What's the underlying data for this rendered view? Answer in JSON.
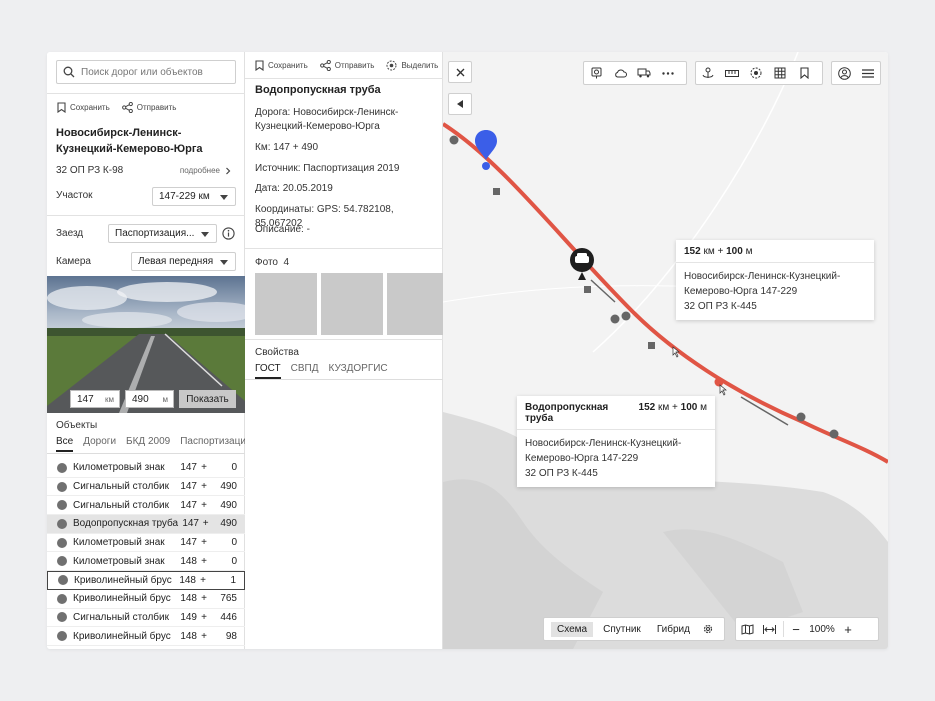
{
  "left": {
    "search_placeholder": "Поиск дорог или объектов",
    "save_label": "Сохранить",
    "send_label": "Отправить",
    "road_title": "Новосибирск-Ленинск-Кузнецкий-Кемерово-Юрга",
    "road_code": "32 ОП РЗ К-98",
    "more_label": "подробнее",
    "section_label": "Участок",
    "section_value": "147-229 км",
    "trip_label": "Заезд",
    "trip_value": "Паспортизация...",
    "camera_label": "Камера",
    "camera_value": "Левая передняя",
    "km_value": "147",
    "km_unit": "км",
    "m_value": "490",
    "m_unit": "м",
    "show_label": "Показать",
    "objects_title": "Объекты",
    "tabs": [
      "Все",
      "Дороги",
      "БКД 2009",
      "Паспортизация"
    ],
    "objects": [
      {
        "name": "Километровый знак",
        "km": "147",
        "m": "0"
      },
      {
        "name": "Сигнальный столбик",
        "km": "147",
        "m": "490"
      },
      {
        "name": "Сигнальный столбик",
        "km": "147",
        "m": "490"
      },
      {
        "name": "Водопропускная труба",
        "km": "147",
        "m": "490"
      },
      {
        "name": "Километровый знак",
        "km": "147",
        "m": "0"
      },
      {
        "name": "Километровый знак",
        "km": "148",
        "m": "0"
      },
      {
        "name": "Криволинейный брус",
        "km": "148",
        "m": "1"
      },
      {
        "name": "Криволинейный брус",
        "km": "148",
        "m": "765"
      },
      {
        "name": "Сигнальный столбик",
        "km": "149",
        "m": "446"
      },
      {
        "name": "Криволинейный брус",
        "km": "148",
        "m": "98"
      }
    ],
    "plus_sign": "+"
  },
  "mid": {
    "save_label": "Сохранить",
    "send_label": "Отправить",
    "select_label": "Выделить",
    "title": "Водопропускная труба",
    "road": "Дорога: Новосибирск-Ленинск-Кузнецкий-Кемерово-Юрга",
    "km": "Км: 147 + 490",
    "source": "Источник: Паспортизация 2019",
    "date": "Дата: 20.05.2019",
    "coords": "Координаты: GPS: 54.782108, 85.067202",
    "description": "Описание: -",
    "photos_label": "Фото",
    "photos_count": "4",
    "props_label": "Свойства",
    "props_tabs": [
      "ГОСТ",
      "СВПД",
      "КУЗДОРГИС"
    ]
  },
  "map": {
    "card1": {
      "km": "152",
      "km_unit": "км",
      "plus": "+",
      "m": "100",
      "m_unit": "м",
      "road": "Новосибирск-Ленинск-Кузнецкий-Кемерово-Юрга 147-229",
      "code": "32 ОП РЗ К-445"
    },
    "card2": {
      "title": "Водопропускная труба",
      "km": "152",
      "km_unit": "км",
      "plus": "+",
      "m": "100",
      "m_unit": "м",
      "road": "Новосибирск-Ленинск-Кузнецкий-Кемерово-Юрга 147-229",
      "code": "32 ОП РЗ К-445"
    },
    "layers": [
      "Схема",
      "Спутник",
      "Гибрид"
    ],
    "zoom": "100%",
    "road_color": "#e05545",
    "pin_color": "#3b5ee8"
  }
}
